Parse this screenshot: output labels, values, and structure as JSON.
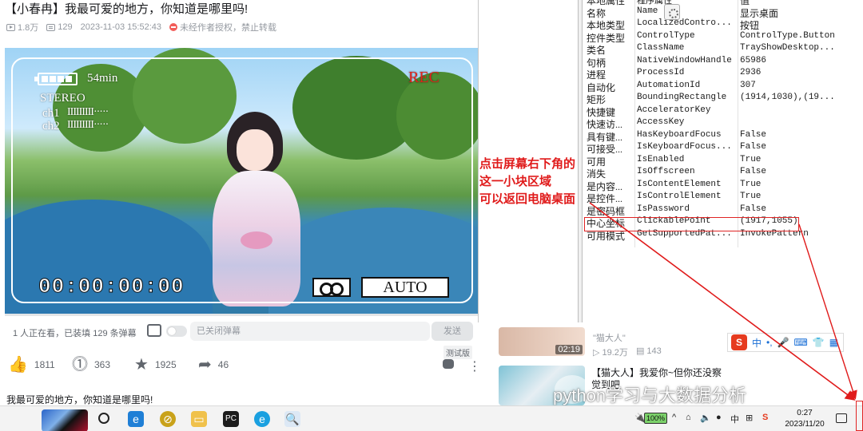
{
  "video": {
    "title": "【小春冉】我最可爱的地方，你知道是哪里吗!",
    "views": "1.8万",
    "danmaku_count": "129",
    "datetime": "2023-11-03 15:52:43",
    "copyright_note": "未经作者授权，禁止转载",
    "osd": {
      "battery": "54min",
      "rec": "REC",
      "stereo": "STEREO",
      "ch1": "ch1",
      "ch2": "ch2",
      "timecode": "00:00:00:00",
      "mode": "AUTO"
    },
    "progress": 0.0
  },
  "danmaku_bar": {
    "watching": "1 人正在看，已装填 129 条弹幕",
    "input_placeholder": "已关闭弹幕",
    "send_label": "发送"
  },
  "actions": {
    "like": "1811",
    "coin": "363",
    "favorite": "1925",
    "share": "46",
    "test_tag": "测试版"
  },
  "description": "我最可爱的地方，你知道是哪里吗!",
  "recommend": [
    {
      "title": "\"猫大人\"",
      "duration": "02:19",
      "views": "19.2万",
      "danmaku": "143"
    },
    {
      "title": "【猫大人】我爱你~但你还没察觉到吧"
    }
  ],
  "inspector": {
    "rows": [
      {
        "k": "本地属性",
        "p": "程序属性",
        "v": "值"
      },
      {
        "k": "名称",
        "p": "Name",
        "v": "显示桌面"
      },
      {
        "k": "本地类型",
        "p": "LocalizedContro...",
        "v": "按钮"
      },
      {
        "k": "控件类型",
        "p": "ControlType",
        "v": "ControlType.Button"
      },
      {
        "k": "类名",
        "p": "ClassName",
        "v": "TrayShowDesktop..."
      },
      {
        "k": "句柄",
        "p": "NativeWindowHandle",
        "v": "65986"
      },
      {
        "k": "进程",
        "p": "ProcessId",
        "v": "2936"
      },
      {
        "k": "自动化",
        "p": "AutomationId",
        "v": "307"
      },
      {
        "k": "矩形",
        "p": "BoundingRectangle",
        "v": "(1914,1030),(19..."
      },
      {
        "k": "快捷键",
        "p": "AcceleratorKey",
        "v": ""
      },
      {
        "k": "快速访...",
        "p": "AccessKey",
        "v": ""
      },
      {
        "k": "具有键...",
        "p": "HasKeyboardFocus",
        "v": "False"
      },
      {
        "k": "可接受...",
        "p": "IsKeyboardFocus...",
        "v": "False"
      },
      {
        "k": "可用",
        "p": "IsEnabled",
        "v": "True"
      },
      {
        "k": "消失",
        "p": "IsOffscreen",
        "v": "False"
      },
      {
        "k": "是内容...",
        "p": "IsContentElement",
        "v": "True"
      },
      {
        "k": "是控件...",
        "p": "IsControlElement",
        "v": "True"
      },
      {
        "k": "是密码框",
        "p": "IsPassword",
        "v": "False"
      },
      {
        "k": "中心坐标",
        "p": "ClickablePoint",
        "v": "(1917,1055)"
      },
      {
        "k": "可用模式",
        "p": "GetSupportedPat...",
        "v": "InvokePattern"
      }
    ]
  },
  "annotation": {
    "line1": "点击屏幕右下角的",
    "line2": "这一小块区域",
    "line3": "可以返回电脑桌面",
    "color": "#e01b1b"
  },
  "ime": {
    "logo": "S",
    "lang": "中"
  },
  "watermark": "python学习与大数据分析",
  "taskbar": {
    "battery": "100%",
    "time": "0:27",
    "date": "2023/11/20",
    "tray_lang": "中"
  }
}
